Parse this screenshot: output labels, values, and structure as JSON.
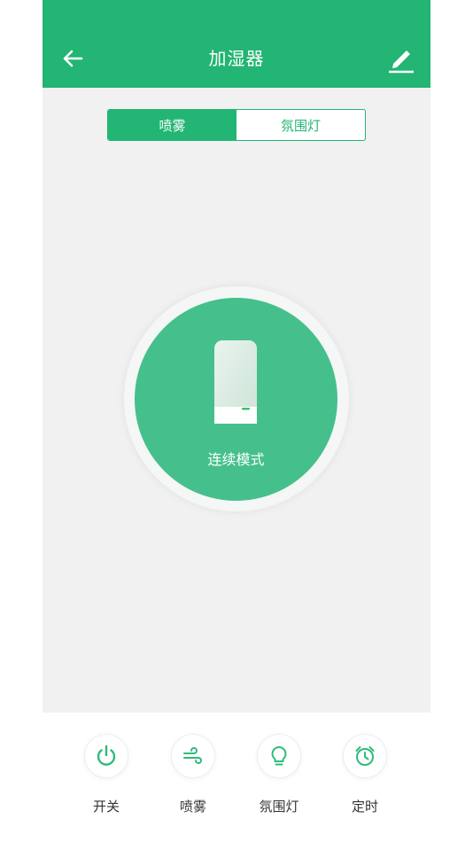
{
  "header": {
    "title": "加湿器"
  },
  "segments": [
    {
      "label": "喷雾",
      "active": true
    },
    {
      "label": "氛围灯",
      "active": false
    }
  ],
  "main": {
    "mode_label": "连续模式"
  },
  "bottom_tabs": [
    {
      "label": "开关",
      "icon": "power-icon"
    },
    {
      "label": "喷雾",
      "icon": "wind-icon"
    },
    {
      "label": "氛围灯",
      "icon": "bulb-icon"
    },
    {
      "label": "定时",
      "icon": "alarm-clock-icon"
    }
  ],
  "colors": {
    "primary": "#22b573",
    "circle": "#45c08c",
    "page_bg": "#f1f1f1"
  }
}
